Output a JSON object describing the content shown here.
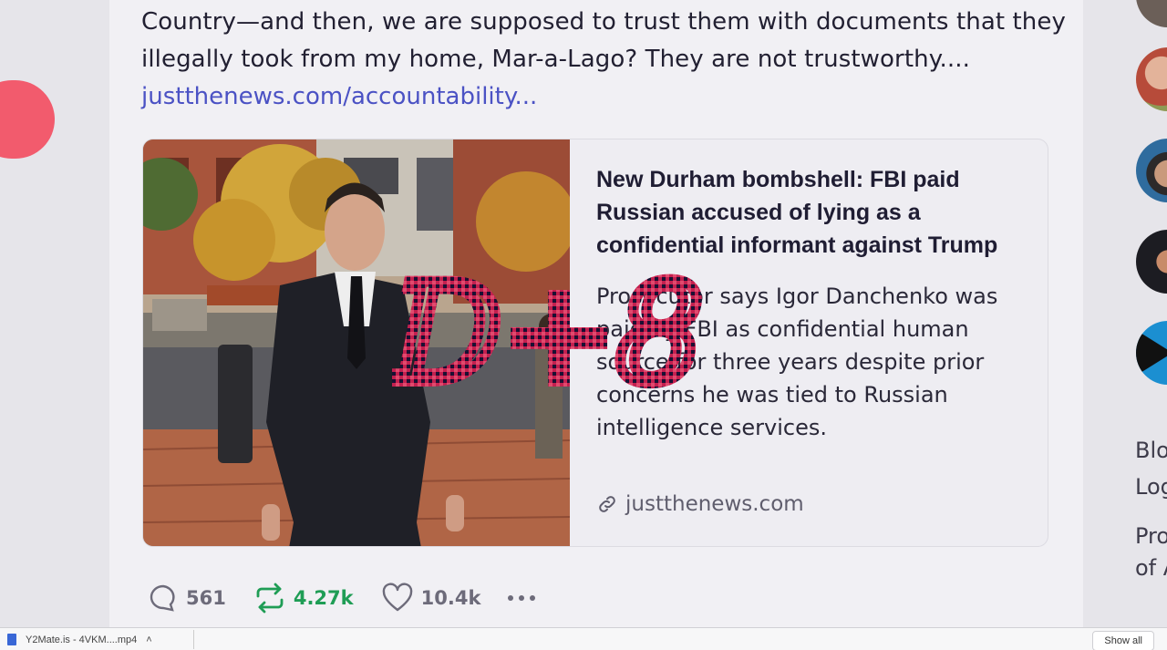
{
  "post": {
    "text_lines": [
      "Country—and then, we are supposed to trust them with documents that they",
      "illegally took from my home, Mar-a-Lago? They are not trustworthy...."
    ],
    "link_text": "justthenews.com/accountability..."
  },
  "preview": {
    "title": "New Durham bombshell: FBI paid Russian accused of lying as a confidential informant against Trump",
    "description": "Prosecutor says Igor Danchenko was paid by FBI as confidential human source for three years despite prior concerns he was tied to Russian intelligence services.",
    "domain": "justthenews.com"
  },
  "actions": {
    "replies": "561",
    "reposts": "4.27k",
    "likes": "10.4k"
  },
  "overlay": {
    "text": "D+8",
    "color": "#c3204f"
  },
  "sidebar": {
    "lines": [
      "Blo",
      "Log",
      "Pro",
      "of A"
    ]
  },
  "download_bar": {
    "file_name": "Y2Mate.is - 4VKM....mp4",
    "show_all": "Show all"
  },
  "colors": {
    "link": "#4b52c4",
    "repost_green": "#1f9d55",
    "accent_red": "#f25b6d"
  }
}
